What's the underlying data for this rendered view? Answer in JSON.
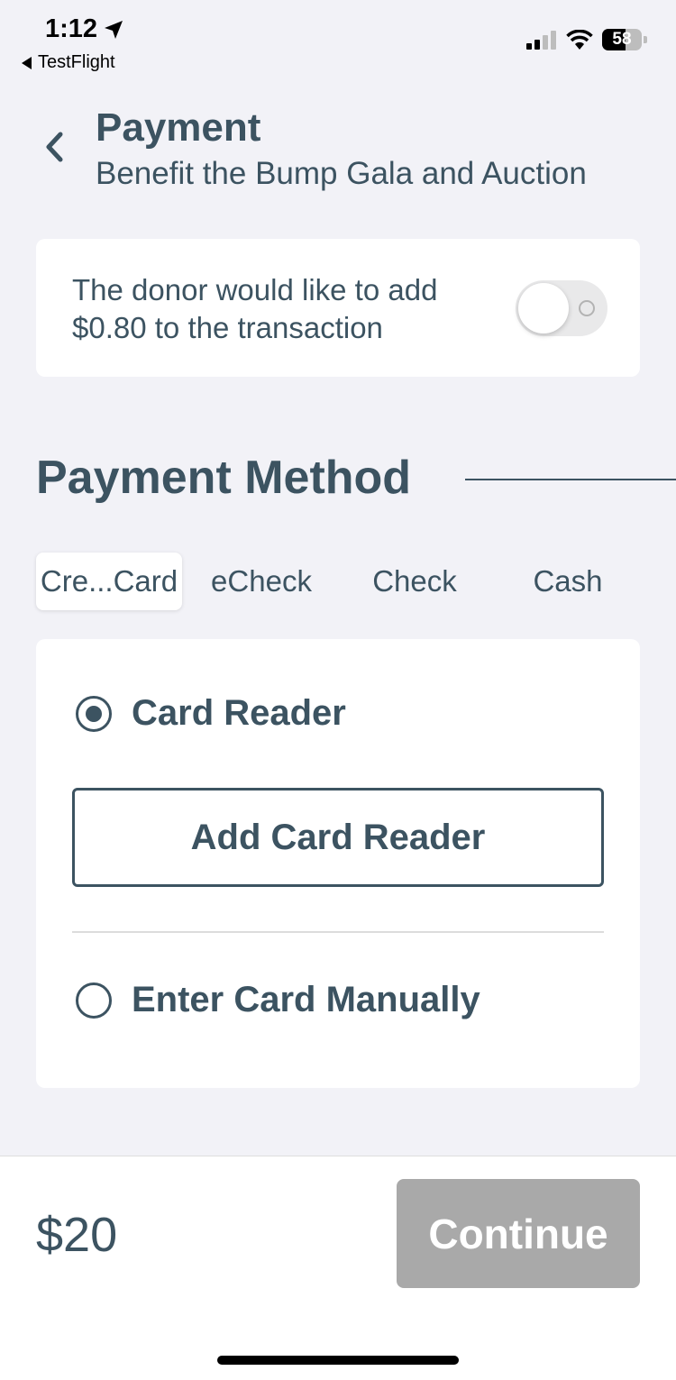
{
  "status_bar": {
    "time": "1:12",
    "back_app": "TestFlight",
    "battery_level": "58",
    "battery_percent": 58
  },
  "header": {
    "title": "Payment",
    "subtitle": "Benefit the Bump Gala and Auction"
  },
  "donor_fee": {
    "text": "The donor would like to add $0.80 to the transaction",
    "toggle_on": false
  },
  "payment_method": {
    "heading": "Payment Method",
    "tabs": [
      {
        "label": "Cre...Card",
        "active": true
      },
      {
        "label": "eCheck",
        "active": false
      },
      {
        "label": "Check",
        "active": false
      },
      {
        "label": "Cash",
        "active": false
      }
    ],
    "options": [
      {
        "label": "Card Reader",
        "selected": true
      },
      {
        "label": "Enter Card Manually",
        "selected": false
      }
    ],
    "add_reader_label": "Add Card Reader"
  },
  "footer": {
    "amount": "$20",
    "continue_label": "Continue"
  },
  "colors": {
    "primary": "#3c5361",
    "background": "#f2f2f7",
    "disabled_button": "#a9a9a9"
  }
}
